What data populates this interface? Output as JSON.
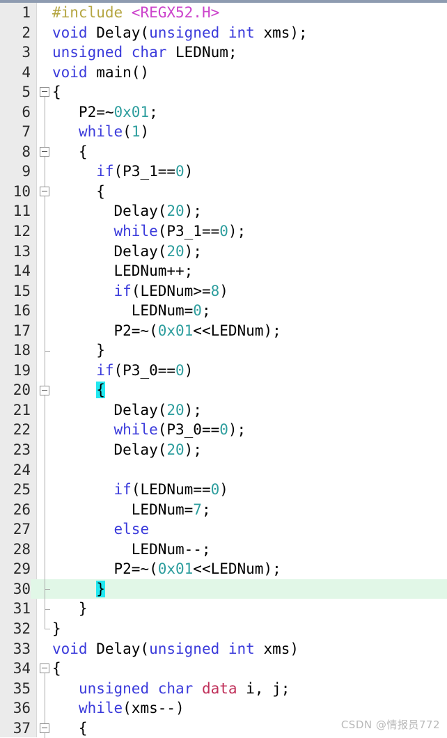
{
  "editor": {
    "language": "c",
    "current_line": 30,
    "colors": {
      "background": "#ffffff",
      "gutter_background": "#ebebeb",
      "line_number": "#2b2b2b",
      "current_line_highlight": "#e1f7e7",
      "bracket_match_highlight": "#22e8f0",
      "preprocessor": "#b5a642",
      "include_path": "#cc44cc",
      "keyword": "#3b3bdb",
      "number": "#2e9e9e",
      "memory_qualifier": "#c0305a",
      "plain_text": "#000000",
      "fold_guide": "#a9a9a9",
      "top_border": "#8e9bb0"
    }
  },
  "watermark": {
    "text": "CSDN @情报员772"
  },
  "lines": [
    {
      "n": 1,
      "fold": "none",
      "current": false,
      "tokens": [
        {
          "t": "#include ",
          "c": "pre"
        },
        {
          "t": "<REGX52.H>",
          "c": "inc"
        }
      ]
    },
    {
      "n": 2,
      "fold": "none",
      "current": false,
      "tokens": [
        {
          "t": "void",
          "c": "kw"
        },
        {
          "t": " Delay(",
          "c": "plain"
        },
        {
          "t": "unsigned int",
          "c": "kw"
        },
        {
          "t": " xms);",
          "c": "plain"
        }
      ]
    },
    {
      "n": 3,
      "fold": "none",
      "current": false,
      "tokens": [
        {
          "t": "unsigned char",
          "c": "kw"
        },
        {
          "t": " LEDNum;",
          "c": "plain"
        }
      ]
    },
    {
      "n": 4,
      "fold": "none",
      "current": false,
      "tokens": [
        {
          "t": "void",
          "c": "kw"
        },
        {
          "t": " main()",
          "c": "plain"
        }
      ]
    },
    {
      "n": 5,
      "fold": "box-open",
      "current": false,
      "tokens": [
        {
          "t": "{",
          "c": "plain"
        }
      ]
    },
    {
      "n": 6,
      "fold": "line",
      "current": false,
      "tokens": [
        {
          "t": "   P2=~",
          "c": "plain"
        },
        {
          "t": "0x01",
          "c": "num"
        },
        {
          "t": ";",
          "c": "plain"
        }
      ]
    },
    {
      "n": 7,
      "fold": "line",
      "current": false,
      "tokens": [
        {
          "t": "   ",
          "c": "plain"
        },
        {
          "t": "while",
          "c": "kw"
        },
        {
          "t": "(",
          "c": "plain"
        },
        {
          "t": "1",
          "c": "num"
        },
        {
          "t": ")",
          "c": "plain"
        }
      ]
    },
    {
      "n": 8,
      "fold": "box-nested",
      "current": false,
      "tokens": [
        {
          "t": "   {",
          "c": "plain"
        }
      ]
    },
    {
      "n": 9,
      "fold": "line",
      "current": false,
      "tokens": [
        {
          "t": "     ",
          "c": "plain"
        },
        {
          "t": "if",
          "c": "kw"
        },
        {
          "t": "(P3_1==",
          "c": "plain"
        },
        {
          "t": "0",
          "c": "num"
        },
        {
          "t": ")",
          "c": "plain"
        }
      ]
    },
    {
      "n": 10,
      "fold": "box-nested",
      "current": false,
      "tokens": [
        {
          "t": "     {",
          "c": "plain"
        }
      ]
    },
    {
      "n": 11,
      "fold": "line",
      "current": false,
      "tokens": [
        {
          "t": "       Delay(",
          "c": "plain"
        },
        {
          "t": "20",
          "c": "num"
        },
        {
          "t": ");",
          "c": "plain"
        }
      ]
    },
    {
      "n": 12,
      "fold": "line",
      "current": false,
      "tokens": [
        {
          "t": "       ",
          "c": "plain"
        },
        {
          "t": "while",
          "c": "kw"
        },
        {
          "t": "(P3_1==",
          "c": "plain"
        },
        {
          "t": "0",
          "c": "num"
        },
        {
          "t": ");",
          "c": "plain"
        }
      ]
    },
    {
      "n": 13,
      "fold": "line",
      "current": false,
      "tokens": [
        {
          "t": "       Delay(",
          "c": "plain"
        },
        {
          "t": "20",
          "c": "num"
        },
        {
          "t": ");",
          "c": "plain"
        }
      ]
    },
    {
      "n": 14,
      "fold": "line",
      "current": false,
      "tokens": [
        {
          "t": "       LEDNum++;",
          "c": "plain"
        }
      ]
    },
    {
      "n": 15,
      "fold": "line",
      "current": false,
      "tokens": [
        {
          "t": "       ",
          "c": "plain"
        },
        {
          "t": "if",
          "c": "kw"
        },
        {
          "t": "(LEDNum>=",
          "c": "plain"
        },
        {
          "t": "8",
          "c": "num"
        },
        {
          "t": ")",
          "c": "plain"
        }
      ]
    },
    {
      "n": 16,
      "fold": "line",
      "current": false,
      "tokens": [
        {
          "t": "         LEDNum=",
          "c": "plain"
        },
        {
          "t": "0",
          "c": "num"
        },
        {
          "t": ";",
          "c": "plain"
        }
      ]
    },
    {
      "n": 17,
      "fold": "line",
      "current": false,
      "tokens": [
        {
          "t": "       P2=~(",
          "c": "plain"
        },
        {
          "t": "0x01",
          "c": "num"
        },
        {
          "t": "<<LEDNum);",
          "c": "plain"
        }
      ]
    },
    {
      "n": 18,
      "fold": "tick",
      "current": false,
      "tokens": [
        {
          "t": "     }",
          "c": "plain"
        }
      ]
    },
    {
      "n": 19,
      "fold": "line",
      "current": false,
      "tokens": [
        {
          "t": "     ",
          "c": "plain"
        },
        {
          "t": "if",
          "c": "kw"
        },
        {
          "t": "(P3_0==",
          "c": "plain"
        },
        {
          "t": "0",
          "c": "num"
        },
        {
          "t": ")",
          "c": "plain"
        }
      ]
    },
    {
      "n": 20,
      "fold": "box-nested",
      "current": false,
      "tokens": [
        {
          "t": "     ",
          "c": "plain"
        },
        {
          "t": "{",
          "c": "match"
        }
      ]
    },
    {
      "n": 21,
      "fold": "line",
      "current": false,
      "tokens": [
        {
          "t": "       Delay(",
          "c": "plain"
        },
        {
          "t": "20",
          "c": "num"
        },
        {
          "t": ");",
          "c": "plain"
        }
      ]
    },
    {
      "n": 22,
      "fold": "line",
      "current": false,
      "tokens": [
        {
          "t": "       ",
          "c": "plain"
        },
        {
          "t": "while",
          "c": "kw"
        },
        {
          "t": "(P3_0==",
          "c": "plain"
        },
        {
          "t": "0",
          "c": "num"
        },
        {
          "t": ");",
          "c": "plain"
        }
      ]
    },
    {
      "n": 23,
      "fold": "line",
      "current": false,
      "tokens": [
        {
          "t": "       Delay(",
          "c": "plain"
        },
        {
          "t": "20",
          "c": "num"
        },
        {
          "t": ");",
          "c": "plain"
        }
      ]
    },
    {
      "n": 24,
      "fold": "line",
      "current": false,
      "tokens": [
        {
          "t": "",
          "c": "plain"
        }
      ]
    },
    {
      "n": 25,
      "fold": "line",
      "current": false,
      "tokens": [
        {
          "t": "       ",
          "c": "plain"
        },
        {
          "t": "if",
          "c": "kw"
        },
        {
          "t": "(LEDNum==",
          "c": "plain"
        },
        {
          "t": "0",
          "c": "num"
        },
        {
          "t": ")",
          "c": "plain"
        }
      ]
    },
    {
      "n": 26,
      "fold": "line",
      "current": false,
      "tokens": [
        {
          "t": "         LEDNum=",
          "c": "plain"
        },
        {
          "t": "7",
          "c": "num"
        },
        {
          "t": ";",
          "c": "plain"
        }
      ]
    },
    {
      "n": 27,
      "fold": "line",
      "current": false,
      "tokens": [
        {
          "t": "       ",
          "c": "plain"
        },
        {
          "t": "else",
          "c": "kw"
        }
      ]
    },
    {
      "n": 28,
      "fold": "line",
      "current": false,
      "tokens": [
        {
          "t": "         LEDNum--;",
          "c": "plain"
        }
      ]
    },
    {
      "n": 29,
      "fold": "line",
      "current": false,
      "tokens": [
        {
          "t": "       P2=~(",
          "c": "plain"
        },
        {
          "t": "0x01",
          "c": "num"
        },
        {
          "t": "<<LEDNum);",
          "c": "plain"
        }
      ]
    },
    {
      "n": 30,
      "fold": "tick",
      "current": true,
      "tokens": [
        {
          "t": "     ",
          "c": "plain"
        },
        {
          "t": "}",
          "c": "match"
        }
      ]
    },
    {
      "n": 31,
      "fold": "tick",
      "current": false,
      "tokens": [
        {
          "t": "   }",
          "c": "plain"
        }
      ]
    },
    {
      "n": 32,
      "fold": "end",
      "current": false,
      "tokens": [
        {
          "t": "}",
          "c": "plain"
        }
      ]
    },
    {
      "n": 33,
      "fold": "none",
      "current": false,
      "tokens": [
        {
          "t": "void",
          "c": "kw"
        },
        {
          "t": " Delay(",
          "c": "plain"
        },
        {
          "t": "unsigned int",
          "c": "kw"
        },
        {
          "t": " xms)",
          "c": "plain"
        }
      ]
    },
    {
      "n": 34,
      "fold": "box-open",
      "current": false,
      "tokens": [
        {
          "t": "{",
          "c": "plain"
        }
      ]
    },
    {
      "n": 35,
      "fold": "line",
      "current": false,
      "tokens": [
        {
          "t": "   ",
          "c": "plain"
        },
        {
          "t": "unsigned char",
          "c": "kw"
        },
        {
          "t": " ",
          "c": "plain"
        },
        {
          "t": "data",
          "c": "mem"
        },
        {
          "t": " i, j;",
          "c": "plain"
        }
      ]
    },
    {
      "n": 36,
      "fold": "line",
      "current": false,
      "tokens": [
        {
          "t": "   ",
          "c": "plain"
        },
        {
          "t": "while",
          "c": "kw"
        },
        {
          "t": "(xms--)",
          "c": "plain"
        }
      ]
    },
    {
      "n": 37,
      "fold": "box-nested",
      "current": false,
      "tokens": [
        {
          "t": "   {",
          "c": "plain"
        }
      ]
    }
  ]
}
